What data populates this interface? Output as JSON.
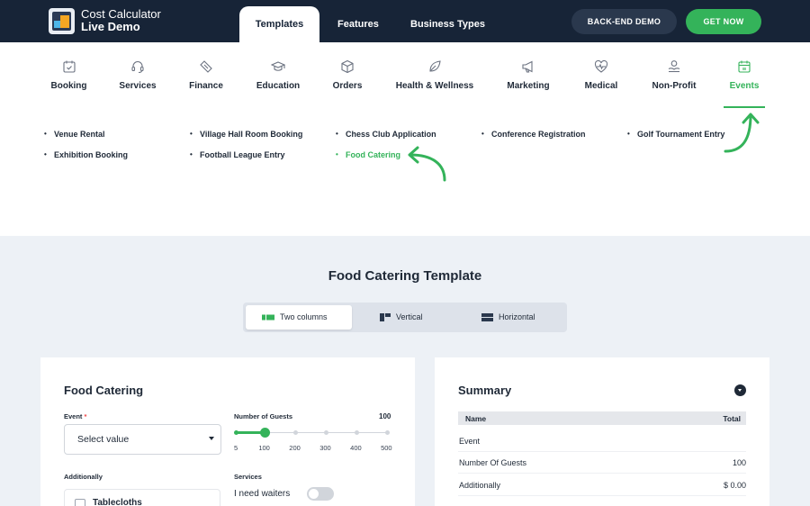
{
  "header": {
    "brand_line1": "Cost Calculator",
    "brand_line2": "Live Demo",
    "tabs": [
      {
        "label": "Templates",
        "active": true
      },
      {
        "label": "Features",
        "active": false
      },
      {
        "label": "Business Types",
        "active": false
      }
    ],
    "backend_demo_label": "BACK-END DEMO",
    "get_now_label": "GET NOW",
    "accent_color": "#34b35a",
    "dark_color": "#172437"
  },
  "categories": [
    {
      "label": "Booking",
      "icon": "calendar-check-icon"
    },
    {
      "label": "Services",
      "icon": "headset-icon"
    },
    {
      "label": "Finance",
      "icon": "ticket-icon"
    },
    {
      "label": "Education",
      "icon": "graduation-cap-icon"
    },
    {
      "label": "Orders",
      "icon": "box-icon"
    },
    {
      "label": "Health & Wellness",
      "icon": "leaf-icon"
    },
    {
      "label": "Marketing",
      "icon": "megaphone-icon"
    },
    {
      "label": "Medical",
      "icon": "heart-pulse-icon"
    },
    {
      "label": "Non-Profit",
      "icon": "hand-coin-icon"
    },
    {
      "label": "Events",
      "icon": "calendar-icon",
      "active": true
    }
  ],
  "templates": [
    {
      "label": "Venue Rental"
    },
    {
      "label": "Village Hall Room Booking"
    },
    {
      "label": "Chess Club Application"
    },
    {
      "label": "Conference Registration"
    },
    {
      "label": "Golf Tournament Entry"
    },
    {
      "label": "Exhibition Booking"
    },
    {
      "label": "Football League Entry"
    },
    {
      "label": "Food Catering",
      "active": true
    }
  ],
  "section_title": "Food Catering Template",
  "layouts": [
    {
      "label": "Two columns",
      "active": true
    },
    {
      "label": "Vertical"
    },
    {
      "label": "Horizontal"
    }
  ],
  "form": {
    "title": "Food Catering",
    "event_label": "Event",
    "event_required_mark": "*",
    "event_placeholder": "Select value",
    "guests_label": "Number of Guests",
    "guests_value": "100",
    "slider": {
      "min": 5,
      "max": 500,
      "value": 100,
      "ticks": [
        "5",
        "100",
        "200",
        "300",
        "400",
        "500"
      ]
    },
    "additionally_label": "Additionally",
    "checkbox_label": "Tablecloths",
    "services_label": "Services",
    "toggle_label": "I need waiters"
  },
  "summary": {
    "title": "Summary",
    "col_name": "Name",
    "col_total": "Total",
    "rows": [
      {
        "name": "Event",
        "value": ""
      },
      {
        "name": "Number Of Guests",
        "value": "100"
      },
      {
        "name": "Additionally",
        "value": "$ 0.00"
      }
    ]
  }
}
